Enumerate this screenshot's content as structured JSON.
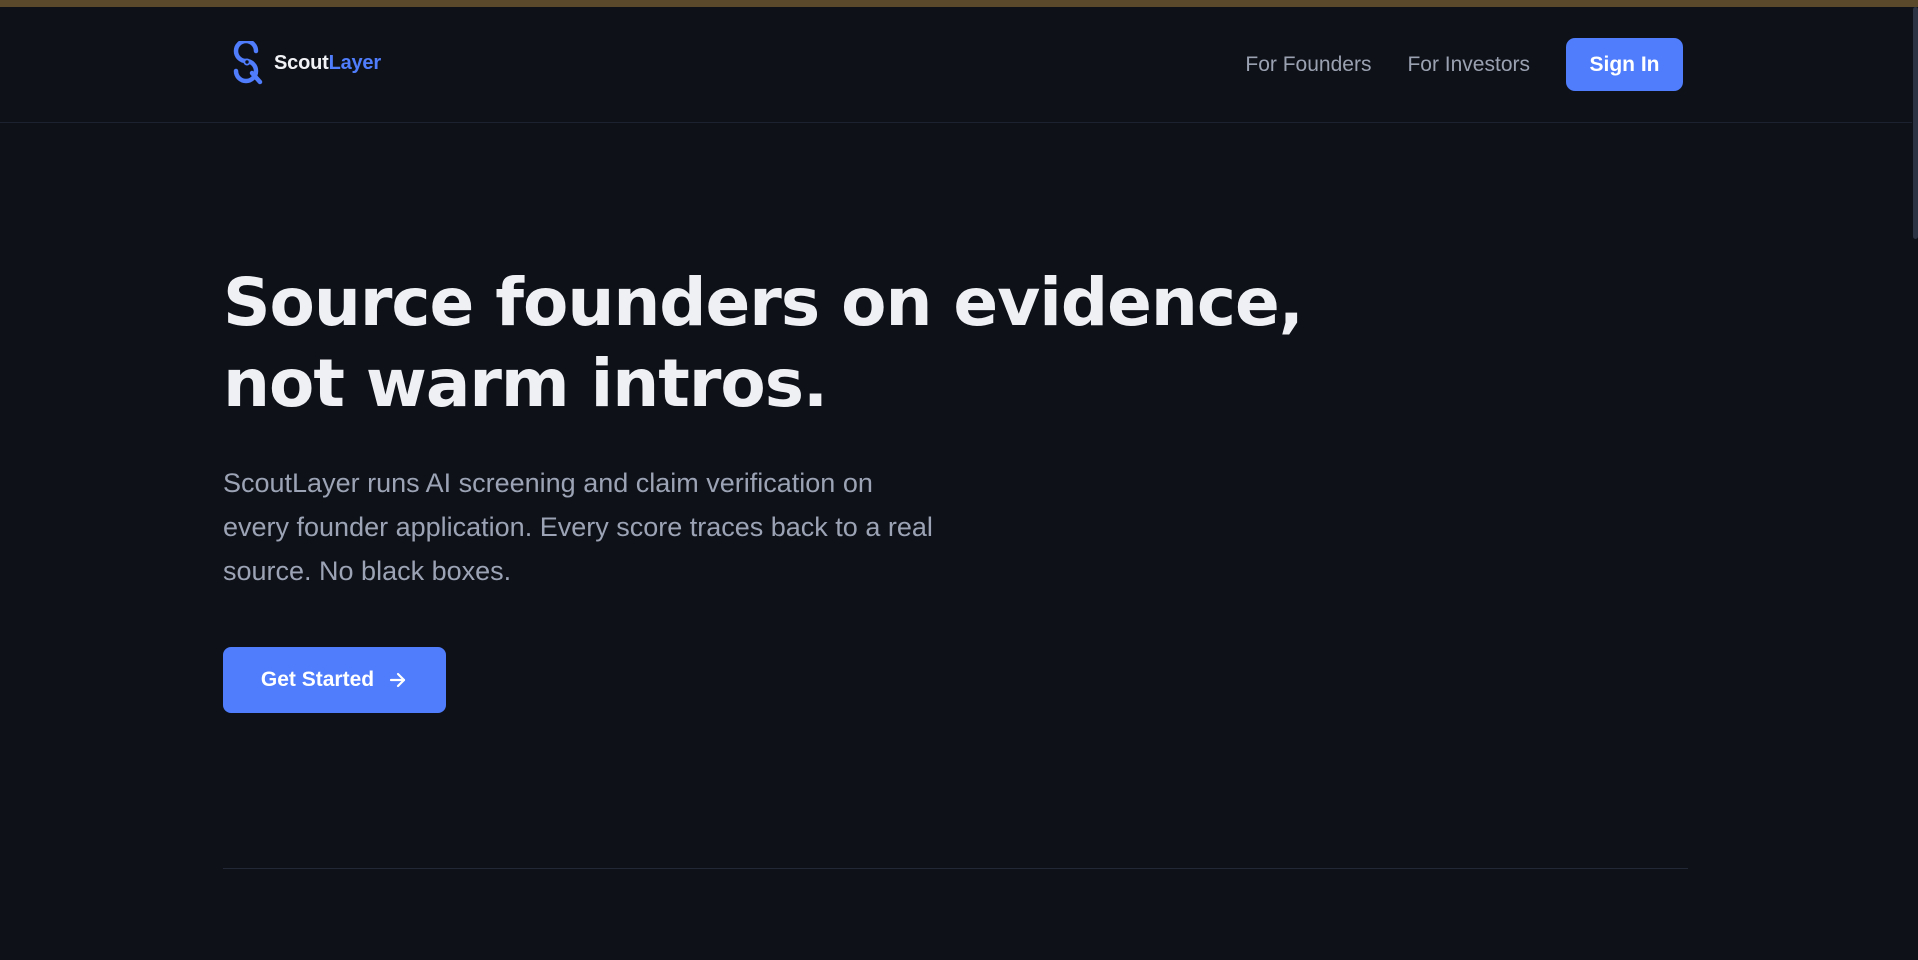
{
  "header": {
    "logo": {
      "word_part1": "Scout",
      "word_part2": "Layer",
      "icon": "magnifier-s-logo-icon"
    },
    "nav": {
      "founders_label": "For Founders",
      "investors_label": "For Investors",
      "signin_label": "Sign In"
    }
  },
  "hero": {
    "title_lines": [
      "Source founders on evidence,",
      "not warm intros."
    ],
    "subtitle_lines": [
      "ScoutLayer runs AI screening and claim verification on",
      "every founder application. Every score traces back to a real",
      "source. No black boxes."
    ],
    "cta": {
      "label": "Get Started",
      "icon": "arrow-right-icon"
    }
  },
  "colors": {
    "background": "#0e1118",
    "accent": "#4f7dfb",
    "top_bar": "#5a4a2b",
    "heading": "#eef0f4",
    "body_text": "#9ba3b4",
    "nav_text": "#9aa1b1"
  }
}
